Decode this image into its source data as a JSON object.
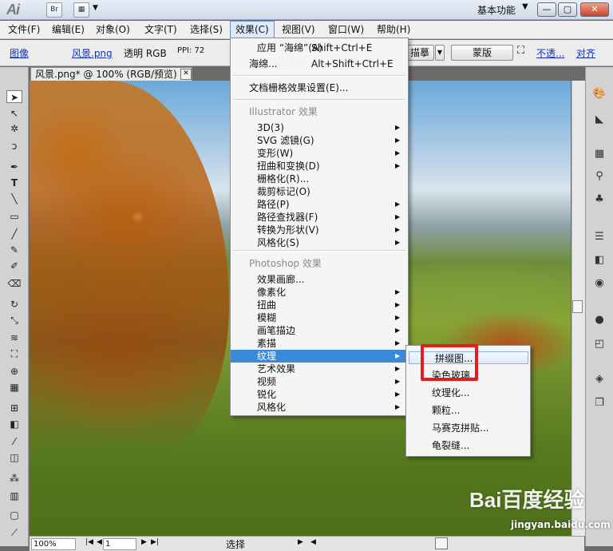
{
  "titlebar": {
    "logo": "Ai",
    "br_label": "Br",
    "workspace": "基本功能",
    "dropdown_arrow": "▼",
    "min_icon": "—",
    "restore_icon": "▢",
    "close_icon": "✕"
  },
  "menubar": {
    "items": [
      "文件(F)",
      "编辑(E)",
      "对象(O)",
      "文字(T)",
      "选择(S)",
      "效果(C)",
      "视图(V)",
      "窗口(W)",
      "帮助(H)"
    ]
  },
  "controlbar": {
    "image": "图像",
    "file": "风景.png",
    "mode": "透明 RGB",
    "ppi": "PPI: 72",
    "trace": "描摹",
    "mask": "蒙版",
    "opacity": "不透...",
    "align": "对齐"
  },
  "document": {
    "tab_title": "风景.png* @ 100% (RGB/预览)",
    "close_icon": "✕"
  },
  "statusbar": {
    "zoom": "100%",
    "page": "1",
    "tool": "选择"
  },
  "effect_menu": {
    "apply_last": {
      "label": "应用 “海绵”(A)",
      "shortcut": "Shift+Ctrl+E"
    },
    "last_effect": {
      "label": "海绵...",
      "shortcut": "Alt+Shift+Ctrl+E"
    },
    "doc_raster": "文档栅格效果设置(E)...",
    "illustrator_header": "Illustrator 效果",
    "illustrator_items": [
      "3D(3)",
      "SVG 滤镜(G)",
      "变形(W)",
      "扭曲和变换(D)",
      "栅格化(R)...",
      "裁剪标记(O)",
      "路径(P)",
      "路径查找器(F)",
      "转换为形状(V)",
      "风格化(S)"
    ],
    "illustrator_arrows": [
      true,
      true,
      true,
      true,
      false,
      false,
      true,
      true,
      true,
      true
    ],
    "photoshop_header": "Photoshop 效果",
    "photoshop_items": [
      "效果画廊...",
      "像素化",
      "扭曲",
      "模糊",
      "画笔描边",
      "素描",
      "纹理",
      "艺术效果",
      "视频",
      "锐化",
      "风格化"
    ],
    "photoshop_arrows": [
      false,
      true,
      true,
      true,
      true,
      true,
      true,
      true,
      true,
      true,
      true
    ],
    "highlighted": "纹理"
  },
  "texture_submenu": {
    "items": [
      "拼缀图...",
      "染色玻璃...",
      "纹理化...",
      "颗粒...",
      "马赛克拼贴...",
      "龟裂缝..."
    ],
    "highlighted": "拼缀图..."
  },
  "watermark": {
    "brand": "Bai百度经验",
    "url": "jingyan.baidu.com"
  },
  "colors": {
    "menu_highlight": "#3b8ad9",
    "annotation_red": "#e02020"
  }
}
